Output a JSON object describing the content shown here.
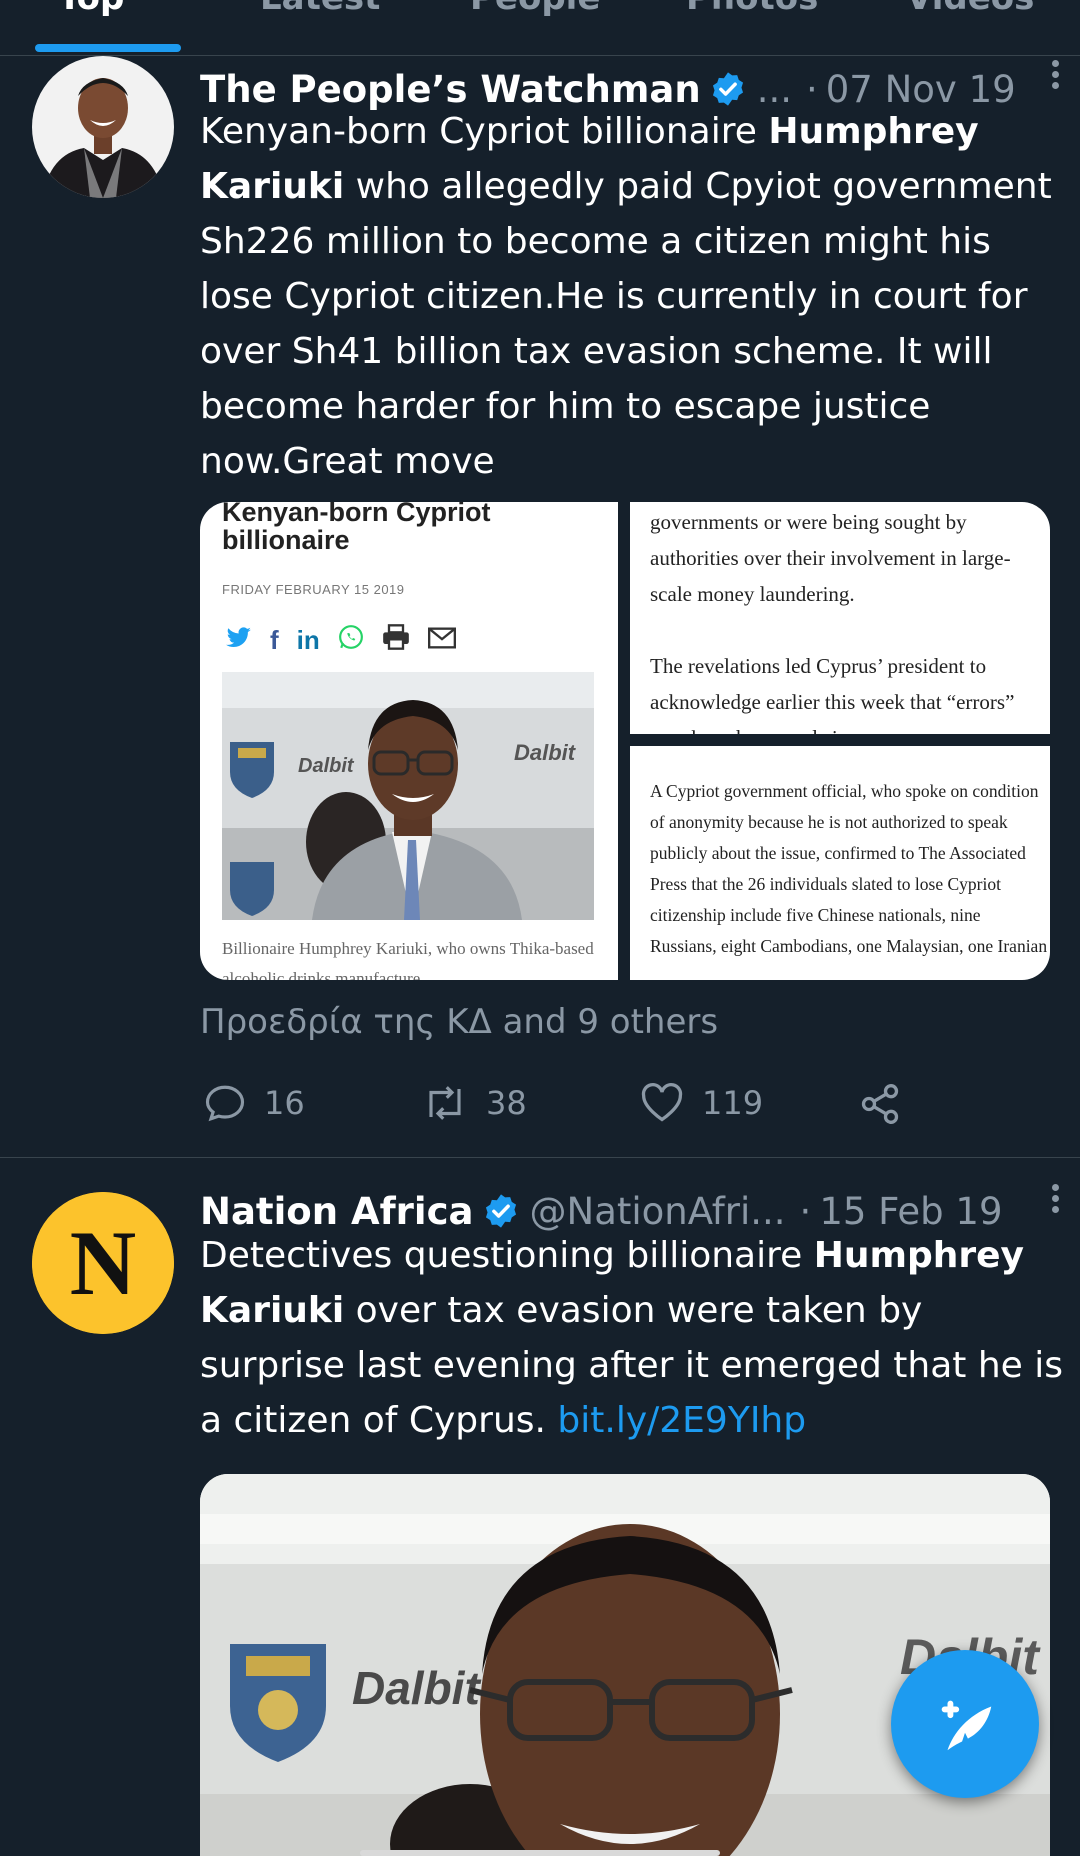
{
  "tabs": [
    {
      "label": "Top",
      "active": true
    },
    {
      "label": "Latest",
      "active": false
    },
    {
      "label": "People",
      "active": false
    },
    {
      "label": "Photos",
      "active": false
    },
    {
      "label": "Videos",
      "active": false
    }
  ],
  "colors": {
    "background": "#15202b",
    "accent": "#1d9bf0",
    "muted": "#8b98a5",
    "divider": "#38444d",
    "avatar_yellow": "#fcc32c"
  },
  "tweets": [
    {
      "author": "The People’s Watchman",
      "verified": true,
      "handle": "...",
      "date": "07 Nov 19",
      "text_parts": [
        {
          "t": "Kenyan-born Cypriot billionaire "
        },
        {
          "t": "Humphrey Kariuki",
          "bold": true
        },
        {
          "t": " who allegedly paid Cpyiot government Sh226 million to become a citizen might his lose Cypriot citizen.He is currently in court for over Sh41 billion tax evasion scheme. It will become harder for him to escape justice now.Great move"
        }
      ],
      "media": {
        "article": {
          "title": "Kenyan-born Cypriot billionaire",
          "date": "FRIDAY FEBRUARY 15 2019",
          "share_icons": [
            "twitter-icon",
            "facebook-icon",
            "linkedin-icon",
            "whatsapp-icon",
            "print-icon",
            "mail-icon"
          ],
          "photo_banner_text": "Dalbit",
          "caption": "Billionaire Humphrey Kariuki, who owns Thika-based alcoholic drinks manufacture"
        },
        "excerpt_top": "governments or were being sought by authorities over their involvement in large-scale money laundering.\n\nThe revelations led Cyprus’ president to acknowledge earlier this week that “errors” may have been made in",
        "excerpt_bottom": "A Cypriot government official, who spoke on condition of anonymity because he is not authorized to speak publicly about the issue, confirmed to The Associated Press that the 26 individuals slated to lose Cypriot citizenship include five Chinese nationals, nine Russians, eight Cambodians, one Malaysian, one Iranian"
      },
      "liked_by": "Προεδρία της ΚΔ and 9 others",
      "stats": {
        "replies": "16",
        "retweets": "38",
        "likes": "119"
      }
    },
    {
      "author": "Nation Africa",
      "verified": true,
      "handle": "@NationAfri...",
      "date": "15 Feb 19",
      "avatar_letter": "N",
      "text_parts": [
        {
          "t": "Detectives questioning billionaire "
        },
        {
          "t": "Humphrey Kariuki",
          "bold": true
        },
        {
          "t": " over tax evasion were taken by surprise last evening after it emerged that he is a citizen of Cyprus. "
        },
        {
          "t": "bit.ly/2E9YIhp",
          "link": true
        }
      ],
      "media_banner_text": "Dalbit"
    }
  ]
}
